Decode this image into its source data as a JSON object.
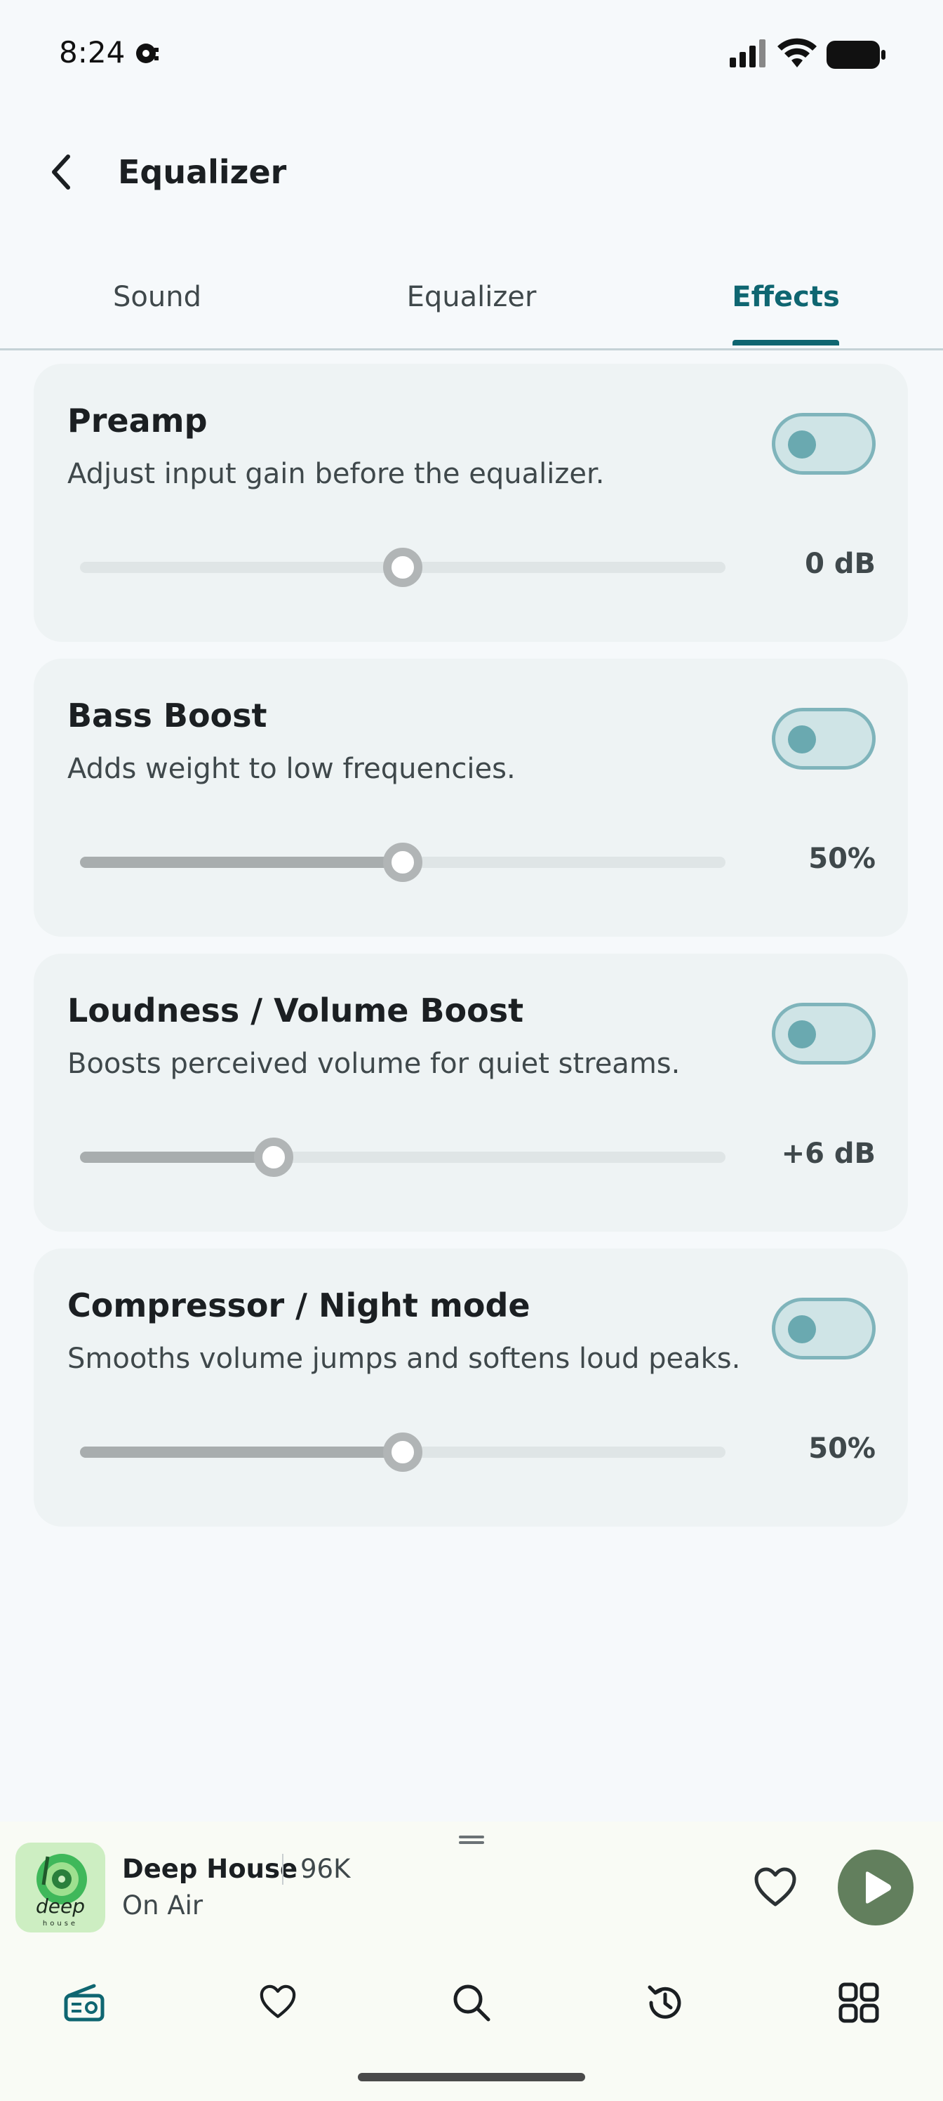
{
  "status_bar": {
    "time": "8:24"
  },
  "app_bar": {
    "title": "Equalizer"
  },
  "tabs": [
    {
      "label": "Sound",
      "active": false
    },
    {
      "label": "Equalizer",
      "active": false
    },
    {
      "label": "Effects",
      "active": true
    }
  ],
  "effects": [
    {
      "title": "Preamp",
      "description": "Adjust input gain before the equalizer.",
      "enabled": false,
      "level": 0.5,
      "value_label": "0 dB",
      "filled": false
    },
    {
      "title": "Bass Boost",
      "description": "Adds weight to low frequencies.",
      "enabled": false,
      "level": 0.5,
      "value_label": "50%",
      "filled": true
    },
    {
      "title": "Loudness / Volume Boost",
      "description": "Boosts perceived volume for quiet streams.",
      "enabled": false,
      "level": 0.3,
      "value_label": "+6 dB",
      "filled": true
    },
    {
      "title": "Compressor / Night mode",
      "description": "Smooths volume jumps and softens loud peaks.",
      "enabled": false,
      "level": 0.5,
      "value_label": "50%",
      "filled": true
    }
  ],
  "player": {
    "station": "Deep House",
    "listeners": "96K",
    "status": "On Air",
    "logo_text": "deep house"
  },
  "nav": [
    {
      "icon": "radio-icon",
      "active": true
    },
    {
      "icon": "heart-icon",
      "active": false
    },
    {
      "icon": "search-icon",
      "active": false
    },
    {
      "icon": "history-icon",
      "active": false
    },
    {
      "icon": "grid-icon",
      "active": false
    }
  ],
  "colors": {
    "accent": "#0f6671",
    "play": "#627f5d"
  }
}
